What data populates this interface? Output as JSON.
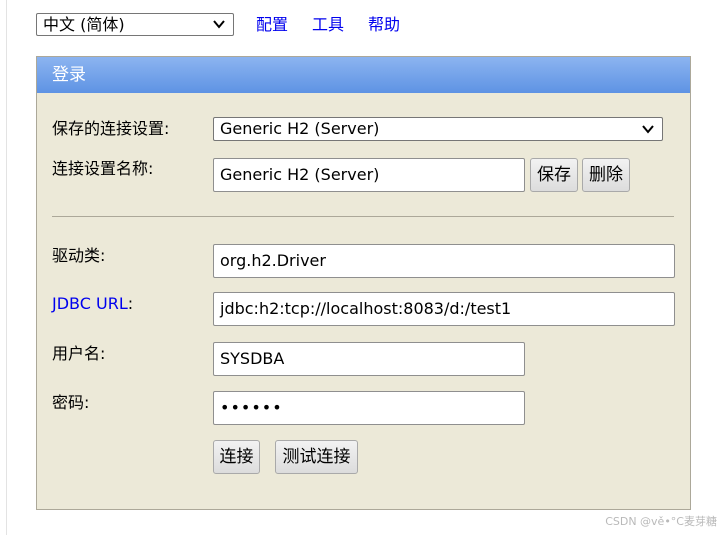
{
  "top_bar": {
    "language_selected": "中文 (简体)",
    "nav_links": [
      "配置",
      "工具",
      "帮助"
    ]
  },
  "login_panel": {
    "title": "登录",
    "saved_settings_label": "保存的连接设置:",
    "saved_settings_value": "Generic H2 (Server)",
    "setting_name_label": "连接设置名称:",
    "setting_name_value": "Generic H2 (Server)",
    "save_button": "保存",
    "delete_button": "删除",
    "driver_label": "驱动类:",
    "driver_value": "org.h2.Driver",
    "jdbc_url_link": "JDBC URL",
    "jdbc_url_colon": ":",
    "jdbc_url_value": "jdbc:h2:tcp://localhost:8083/d:/test1",
    "username_label": "用户名:",
    "username_value": "SYSDBA",
    "password_label": "密码:",
    "password_value": "••••••",
    "connect_button": "连接",
    "test_connection_button": "测试连接"
  },
  "watermark": "CSDN @vě•°C麦芽糖",
  "colors": {
    "panel_bg": "#ece9d8",
    "header_top": "#8cb4f0",
    "header_bottom": "#5e93e4",
    "link": "#0000ee"
  },
  "icons": {
    "dropdown": "chevron-down-icon"
  }
}
